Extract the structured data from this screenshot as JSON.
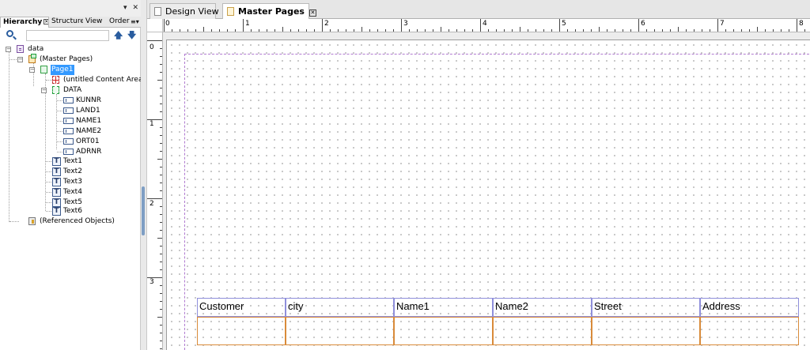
{
  "panel": {
    "controls": {
      "menu": "▾",
      "close": "✕"
    },
    "tabs": [
      {
        "label": "Hierarchy",
        "close": "✕"
      },
      {
        "label": "Structure"
      },
      {
        "label": "View"
      },
      {
        "label": "Order"
      }
    ],
    "tab_menu": "≡▾",
    "search": {
      "value": "",
      "placeholder": ""
    },
    "nav": {
      "up": "🡅",
      "down": "🡇"
    }
  },
  "tree": {
    "root": "data",
    "master_pages": "(Master Pages)",
    "page1": "Page1",
    "content_area": "(untitled Content Area)",
    "subform": "DATA",
    "fields": [
      "KUNNR",
      "LAND1",
      "NAME1",
      "NAME2",
      "ORT01",
      "ADRNR"
    ],
    "texts": [
      "Text1",
      "Text2",
      "Text3",
      "Text4",
      "Text5",
      "Text6"
    ],
    "referenced": "(Referenced Objects)",
    "text_icon_glyph": "T",
    "toggle_glyph": "−"
  },
  "editor": {
    "tabs": [
      {
        "label": "Design View"
      },
      {
        "label": "Master Pages",
        "close": "✕"
      }
    ],
    "ruler_h": [
      "0",
      "1",
      "2",
      "3",
      "4",
      "5",
      "6",
      "7",
      "8"
    ],
    "ruler_v": [
      "0",
      "1",
      "2",
      "3"
    ]
  },
  "table": {
    "headers": [
      "Customer",
      "city",
      "Name1",
      "Name2",
      "Street",
      "Address"
    ]
  },
  "colors": {
    "selection": "#3399ff",
    "header_border": "#8f8fdb",
    "data_border": "#d98b3a",
    "content_area": "#b07ad0"
  }
}
